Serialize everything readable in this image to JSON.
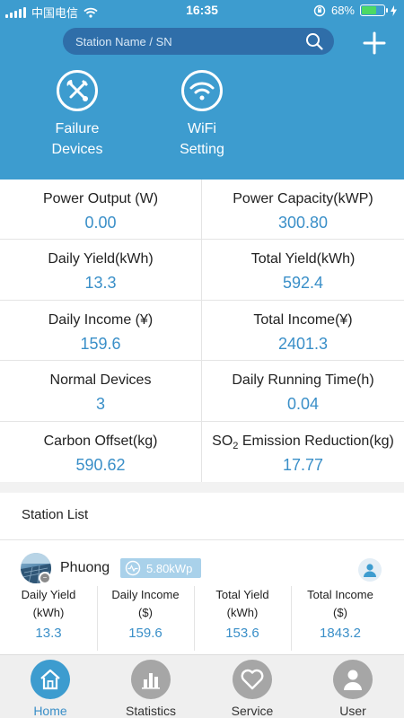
{
  "status_bar": {
    "carrier": "中国电信",
    "time": "16:35",
    "battery": "68%",
    "battery_level": 0.68
  },
  "search": {
    "placeholder": "Station Name / SN"
  },
  "quick_actions": [
    {
      "label": "Failure\nDevices",
      "icon": "wrench-screwdriver-icon"
    },
    {
      "label": "WiFi\nSetting",
      "icon": "wifi-icon"
    }
  ],
  "metrics": {
    "power_output": {
      "label": "Power Output (W)",
      "value": "0.00"
    },
    "power_capacity": {
      "label": "Power Capacity(kWP)",
      "value": "300.80"
    },
    "daily_yield": {
      "label": "Daily Yield(kWh)",
      "value": "13.3"
    },
    "total_yield": {
      "label": "Total Yield(kWh)",
      "value": "592.4"
    },
    "daily_income": {
      "label": "Daily Income (¥)",
      "value": "159.6"
    },
    "total_income": {
      "label": "Total Income(¥)",
      "value": "2401.3"
    },
    "normal_devices": {
      "label": "Normal Devices",
      "value": "3"
    },
    "daily_running_time": {
      "label": "Daily Running Time(h)",
      "value": "0.04"
    },
    "carbon_offset": {
      "label": "Carbon Offset(kg)",
      "value": "590.62"
    },
    "so2_reduction": {
      "label_prefix": "SO",
      "label_sub": "2",
      "label_suffix": " Emission Reduction(kg)",
      "value": "17.77"
    }
  },
  "station_list": {
    "title": "Station List",
    "station": {
      "name": "Phuong",
      "capacity": "5.80kWp",
      "stats": [
        {
          "label": "Daily Yield\n(kWh)",
          "value": "13.3"
        },
        {
          "label": "Daily Income\n($)",
          "value": "159.6"
        },
        {
          "label": "Total Yield\n(kWh)",
          "value": "153.6"
        },
        {
          "label": "Total Income\n($)",
          "value": "1843.2"
        }
      ]
    }
  },
  "tabs": [
    {
      "label": "Home",
      "icon": "home-icon",
      "active": true
    },
    {
      "label": "Statistics",
      "icon": "bar-chart-icon",
      "active": false
    },
    {
      "label": "Service",
      "icon": "heart-icon",
      "active": false
    },
    {
      "label": "User",
      "icon": "user-icon",
      "active": false
    }
  ],
  "colors": {
    "header": "#3d9ccf",
    "accent_text": "#3a8fc8",
    "search_bg": "#2f6ea9",
    "tab_inactive": "#a6a6a6"
  }
}
